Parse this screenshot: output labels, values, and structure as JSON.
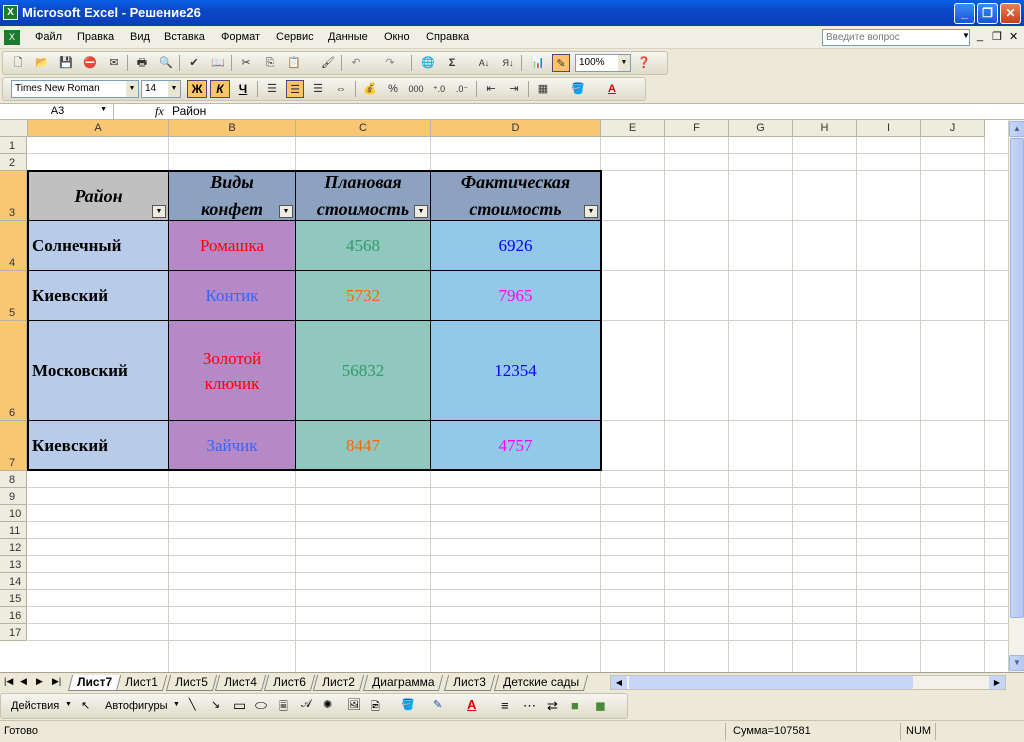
{
  "window": {
    "title": "Microsoft Excel - Решение26",
    "app_icon": "excel-icon"
  },
  "menu": {
    "items": [
      "Файл",
      "Правка",
      "Вид",
      "Вставка",
      "Формат",
      "Сервис",
      "Данные",
      "Окно",
      "Справка"
    ],
    "help_placeholder": "Введите вопрос"
  },
  "standard_toolbar": {
    "zoom": "100%"
  },
  "format_toolbar": {
    "font": "Times New Roman",
    "size": "14",
    "bold_label": "Ж",
    "italic_label": "К",
    "underline_label": "Ч",
    "percent_label": "%",
    "thousands_label": "000"
  },
  "formula_bar": {
    "name_box": "A3",
    "fx": "fx",
    "content": "Район"
  },
  "columns": [
    "A",
    "B",
    "C",
    "D",
    "E",
    "F",
    "G",
    "H",
    "I",
    "J"
  ],
  "rows": [
    "1",
    "2",
    "3",
    "4",
    "5",
    "6",
    "7",
    "8",
    "9",
    "10",
    "11",
    "12",
    "13",
    "14",
    "15",
    "16",
    "17"
  ],
  "table": {
    "headers": [
      "Район",
      "Виды конфет",
      "Плановая стоимость",
      "Фактическая стоимость"
    ],
    "rows": [
      [
        "Солнечный",
        "Ромашка",
        "4568",
        "6926"
      ],
      [
        "Киевский",
        "Контик",
        "5732",
        "7965"
      ],
      [
        "Московский",
        "Золотой ключик",
        "56832",
        "12354"
      ],
      [
        "Киевский",
        "Зайчик",
        "8447",
        "4757"
      ]
    ]
  },
  "colors": {
    "header_a": "#C0C0C0",
    "header_bcd": "#8DA2C0",
    "col_a": "#B8CBE8",
    "col_b": "#B588C6",
    "col_c": "#90C8C0",
    "col_d": "#93C8E8",
    "text_b": [
      "#FF0000",
      "#3366FF",
      "#FF0000",
      "#3366FF"
    ],
    "text_c": [
      "#339966",
      "#FF6600",
      "#339966",
      "#FF6600"
    ],
    "text_d": [
      "#0000FF",
      "#FF00FF",
      "#0000FF",
      "#FF00FF"
    ]
  },
  "sheet_tabs": [
    "Лист7",
    "Лист1",
    "Лист5",
    "Лист4",
    "Лист6",
    "Лист2",
    "Диаграмма",
    "Лист3",
    "Детские сады"
  ],
  "active_tab": "Лист7",
  "drawing_toolbar": {
    "actions": "Действия",
    "autoshapes": "Автофигуры"
  },
  "status": {
    "ready": "Готово",
    "sum": "Сумма=107581",
    "num": "NUM"
  }
}
